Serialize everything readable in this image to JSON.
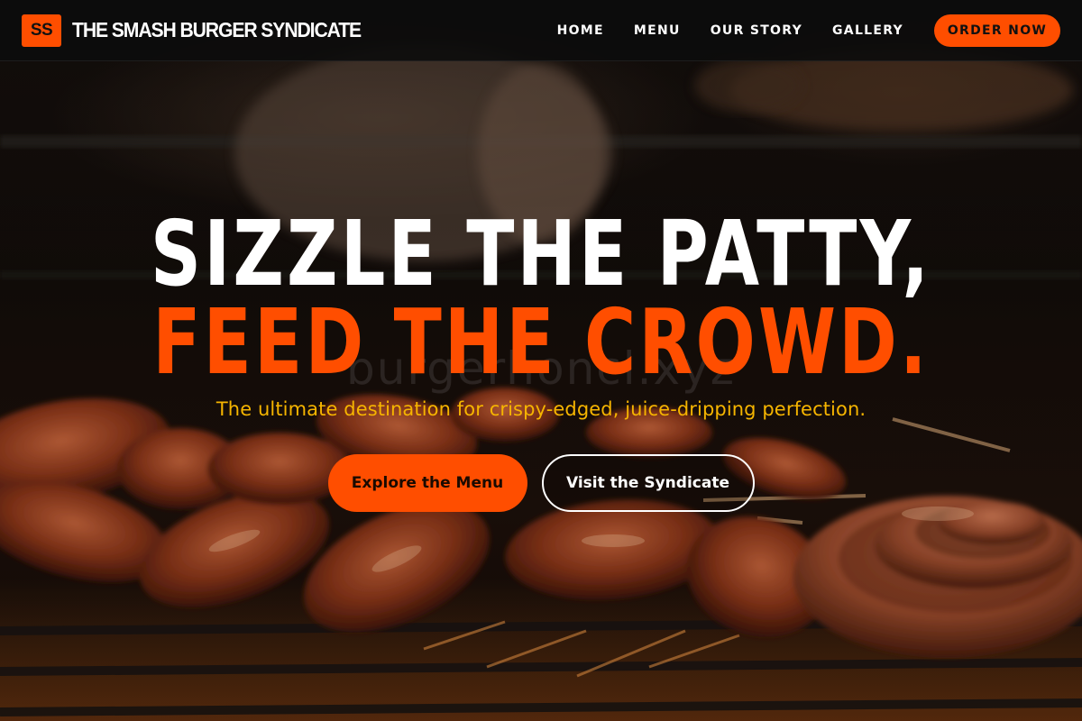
{
  "brand": {
    "logo_initials": "SS",
    "name": "THE SMASH BURGER SYNDICATE"
  },
  "nav": {
    "items": [
      {
        "label": "HOME"
      },
      {
        "label": "MENU"
      },
      {
        "label": "OUR STORY"
      },
      {
        "label": "GALLERY"
      }
    ],
    "cta_label": "ORDER NOW"
  },
  "hero": {
    "headline_line1": "SIZZLE THE PATTY,",
    "headline_line2": "FEED THE CROWD.",
    "watermark": "burgerhoncl.xyz",
    "subheadline": "The ultimate destination for crispy-edged, juice-dripping perfection.",
    "primary_cta": "Explore the Menu",
    "secondary_cta": "Visit the Syndicate"
  },
  "colors": {
    "accent": "#ff4e00",
    "subhead": "#f6b500",
    "nav_bg": "#0c0c0c"
  },
  "background": {
    "subject": "meat-on-grill-photo"
  }
}
